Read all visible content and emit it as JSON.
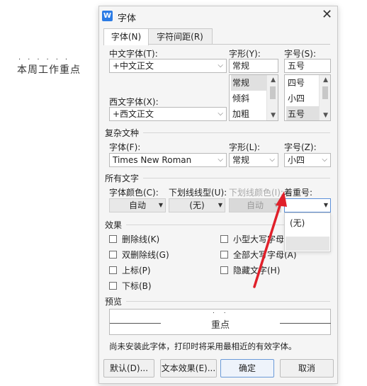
{
  "document": {
    "text": "本周工作重点",
    "emphasis_dots": "......"
  },
  "dialog": {
    "title": "字体",
    "app_icon": "W",
    "close": "✕",
    "tabs": [
      {
        "label": "字体(N)"
      },
      {
        "label": "字符间距(R)"
      }
    ],
    "chinese_font": {
      "label": "中文字体(T):",
      "value": "+中文正文"
    },
    "style": {
      "label": "字形(Y):",
      "value": "常规",
      "options": [
        "常规",
        "倾斜",
        "加粗"
      ]
    },
    "size": {
      "label": "字号(S):",
      "value": "五号",
      "options": [
        "四号",
        "小四",
        "五号"
      ]
    },
    "western_font": {
      "label": "西文字体(X):",
      "value": "+西文正文"
    },
    "complex": {
      "title": "复杂文种",
      "font_label": "字体(F):",
      "font_value": "Times New Roman",
      "style_label": "字形(L):",
      "style_value": "常规",
      "size_label": "字号(Z):",
      "size_value": "小四"
    },
    "all_text": {
      "title": "所有文字",
      "color_label": "字体颜色(C):",
      "color_value": "自动",
      "underline_label": "下划线线型(U):",
      "underline_value": "(无)",
      "underline_color_label": "下划线颜色(I):",
      "underline_color_value": "自动",
      "emphasis_label": "着重号:",
      "emphasis_value": "",
      "emphasis_options": [
        "(无)",
        ""
      ]
    },
    "effects": {
      "title": "效果",
      "items": [
        "删除线(K)",
        "双删除线(G)",
        "上标(P)",
        "下标(B)",
        "小型大写字母(M)",
        "全部大写字母(A)",
        "隐藏文字(H)"
      ]
    },
    "preview": {
      "title": "预览",
      "sample_text": "重点",
      "sample_dots": ". ."
    },
    "note": "尚未安装此字体，打印时将采用最相近的有效字体。",
    "buttons": {
      "default": "默认(D)...",
      "text_effects": "文本效果(E)...",
      "ok": "确定",
      "cancel": "取消"
    }
  },
  "colors": {
    "annotation_arrow": "#e0202a",
    "focus_border": "#5b8fd9",
    "app_icon": "#2b7be5"
  }
}
